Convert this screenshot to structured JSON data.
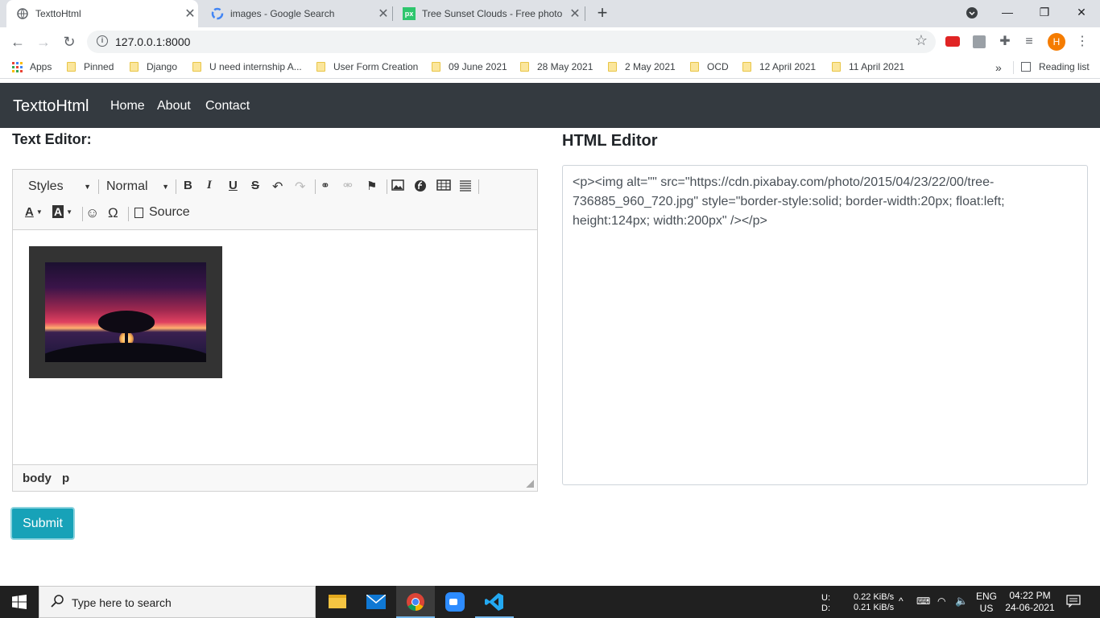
{
  "browser": {
    "tabs": [
      {
        "title": "TexttoHtml",
        "active": true
      },
      {
        "title": "images - Google Search",
        "active": false
      },
      {
        "title": "Tree Sunset Clouds - Free photo",
        "active": false
      }
    ],
    "url": "127.0.0.1:8000",
    "profile_initial": "H",
    "bookmarks": [
      "Apps",
      "Pinned",
      "Django",
      "U need internship A...",
      "User Form Creation",
      "09 June 2021",
      "28 May 2021",
      "2 May 2021",
      "OCD",
      "12 April 2021",
      "11 April 2021"
    ],
    "reading_list": "Reading list",
    "more_bookmarks": "»"
  },
  "navbar": {
    "brand": "TexttoHtml",
    "links": [
      "Home",
      "About",
      "Contact"
    ]
  },
  "text_editor": {
    "heading": "Text Editor:",
    "styles_label": "Styles",
    "format_label": "Normal",
    "source_label": "Source",
    "path": [
      "body",
      "p"
    ]
  },
  "html_editor": {
    "heading": "HTML Editor",
    "content": "<p><img alt=\"\" src=\"https://cdn.pixabay.com/photo/2015/04/23/22/00/tree-736885_960_720.jpg\" style=\"border-style:solid; border-width:20px; float:left; height:124px; width:200px\" /></p>"
  },
  "submit_label": "Submit",
  "taskbar": {
    "search_placeholder": "Type here to search",
    "net_up_label": "U:",
    "net_down_label": "D:",
    "net_up": "0.22 KiB/s",
    "net_down": "0.21 KiB/s",
    "lang": "ENG",
    "region": "US",
    "time": "04:22 PM",
    "date": "24-06-2021"
  },
  "colors": {
    "navbar_bg": "#343a40",
    "submit_bg": "#17a2b8",
    "taskbar_bg": "#202020"
  }
}
